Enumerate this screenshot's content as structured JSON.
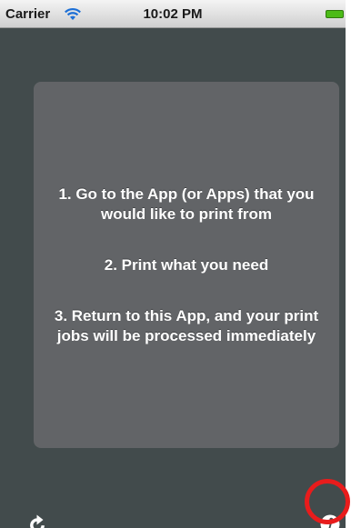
{
  "status_bar": {
    "carrier": "Carrier",
    "time": "10:02 PM",
    "wifi_icon": "wifi-icon",
    "battery_icon": "battery-icon",
    "battery_color": "#4cbb17"
  },
  "instructions": {
    "step_1": "1. Go to the App (or Apps) that you would like to print from",
    "step_2": "2. Print what you need",
    "step_3": "3. Return to this App, and your print jobs will be processed immediately"
  },
  "toolbar": {
    "refresh_icon": "refresh-icon",
    "info_icon": "info-icon"
  },
  "colors": {
    "background": "#424b4c",
    "card": "#626467",
    "highlight": "#e81c1c"
  }
}
